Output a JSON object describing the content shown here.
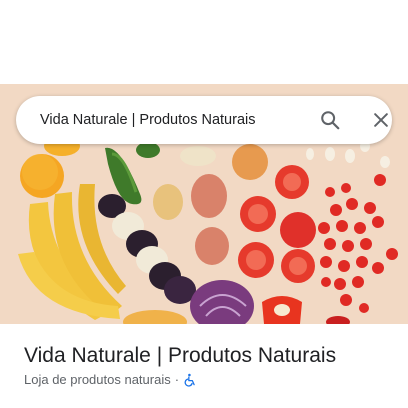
{
  "search": {
    "query": "Vida Naturale | Produtos Naturais"
  },
  "icons": {
    "search": "search-icon",
    "close": "close-icon",
    "accessibility": "wheelchair-icon"
  },
  "place": {
    "name": "Vida Naturale | Produtos Naturais",
    "category": "Loja de produtos naturais",
    "separator": "·"
  },
  "colors": {
    "accessibility_icon": "#1a73e8"
  }
}
